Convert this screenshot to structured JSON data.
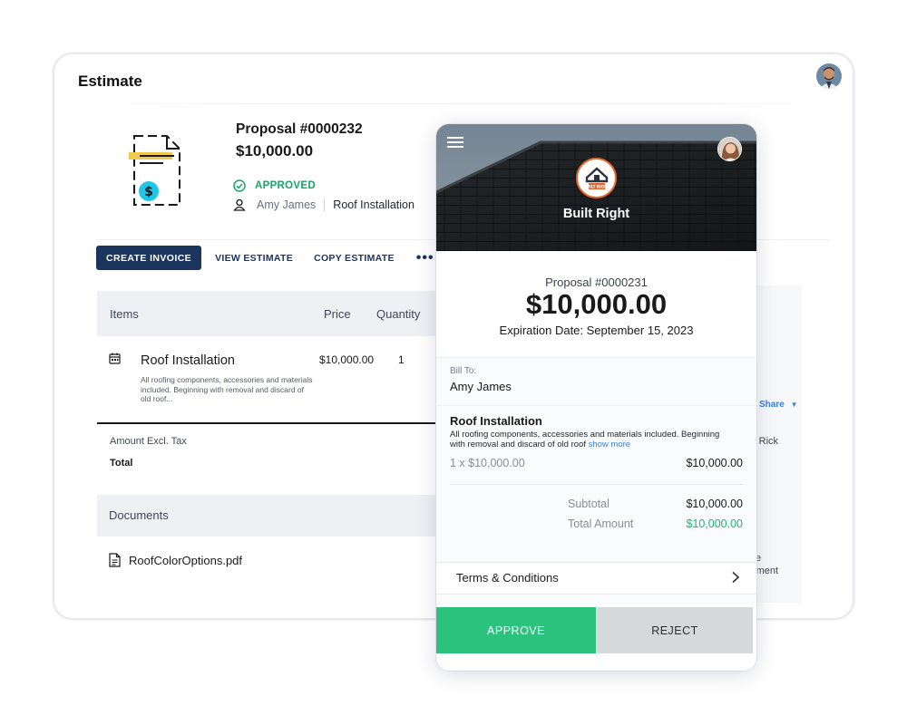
{
  "estimate": {
    "title": "Estimate",
    "proposal_number": "Proposal #0000232",
    "amount": "$10,000.00",
    "status": "APPROVED",
    "customer_name": "Amy James",
    "job_name": "Roof Installation",
    "actions": {
      "create_invoice": "CREATE INVOICE",
      "view_estimate": "VIEW ESTIMATE",
      "copy_estimate": "COPY ESTIMATE",
      "more": "•••"
    },
    "items_table": {
      "headers": {
        "items": "Items",
        "price": "Price",
        "quantity": "Quantity"
      },
      "rows": [
        {
          "name": "Roof Installation",
          "description": "All roofing components, accessories and materials included. Beginning with removal and discard of old roof...",
          "price": "$10,000.00",
          "quantity": "1"
        }
      ]
    },
    "totals": {
      "amount_excl_tax_label": "Amount Excl. Tax",
      "total_label": "Total"
    },
    "documents": {
      "header": "Documents",
      "files": [
        "RoofColorOptions.pdf"
      ]
    },
    "right_panel": {
      "share": "Share",
      "by_rick": "by Rick",
      "te": "te",
      "ayment": "ayment"
    }
  },
  "phone": {
    "brand_name": "Built Right",
    "brand_logo_text": "BUILT RIGHT",
    "proposal_number": "Proposal #0000231",
    "amount": "$10,000.00",
    "expiration": "Expiration Date: September 15, 2023",
    "bill_to_label": "Bill To:",
    "bill_to_name": "Amy James",
    "item": {
      "name": "Roof Installation",
      "description": "All roofing components, accessories and materials included. Beginning with removal and discard of old roof",
      "show_more": "show more",
      "line": "1 x $10,000.00",
      "line_amount": "$10,000.00"
    },
    "subtotal_label": "Subtotal",
    "subtotal": "$10,000.00",
    "total_label": "Total Amount",
    "total": "$10,000.00",
    "terms_label": "Terms & Conditions",
    "approve_label": "APPROVE",
    "reject_label": "REJECT"
  },
  "colors": {
    "primary_navy": "#1c355e",
    "approved_green": "#17a46b",
    "approve_button": "#2bc27e",
    "reject_button": "#d7d8da",
    "link_blue": "#3d7fd9",
    "brand_orange": "#e0672d"
  }
}
